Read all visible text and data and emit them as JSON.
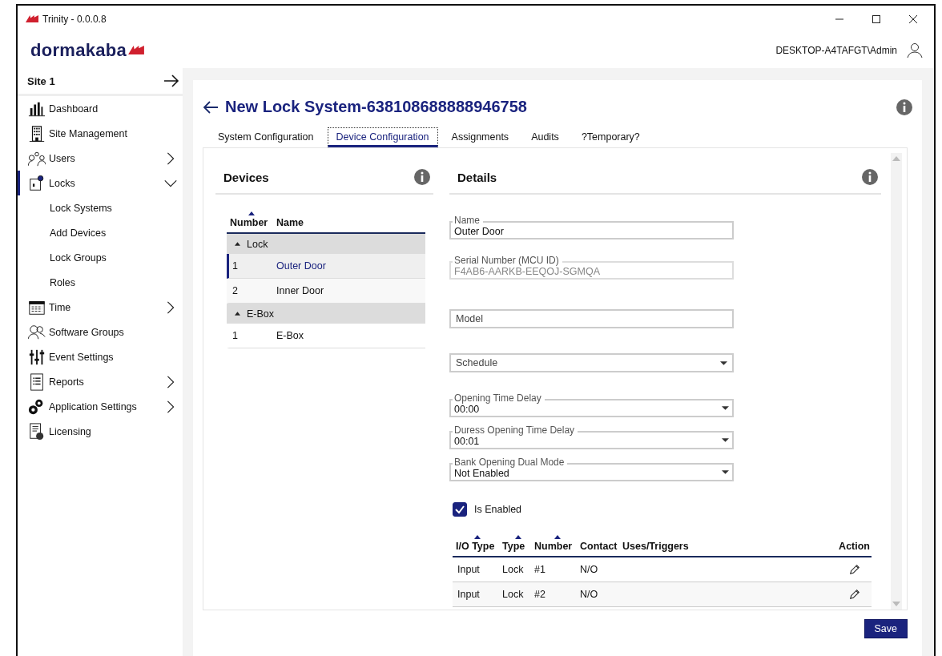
{
  "window": {
    "title": "Trinity - 0.0.0.8"
  },
  "header": {
    "logo": "dormakaba",
    "user": "DESKTOP-A4TAFGT\\Admin"
  },
  "sidebar": {
    "site": "Site 1",
    "items": [
      {
        "label": "Dashboard",
        "selected": false
      },
      {
        "label": "Site Management",
        "selected": false
      },
      {
        "label": "Users",
        "selected": false,
        "expanded": false
      },
      {
        "label": "Locks",
        "selected": true,
        "expanded": true,
        "children": [
          {
            "label": "Lock Systems"
          },
          {
            "label": "Add Devices"
          },
          {
            "label": "Lock Groups"
          },
          {
            "label": "Roles"
          }
        ]
      },
      {
        "label": "Time",
        "selected": false,
        "expanded": false
      },
      {
        "label": "Software Groups",
        "selected": false
      },
      {
        "label": "Event Settings",
        "selected": false
      },
      {
        "label": "Reports",
        "selected": false,
        "expanded": false
      },
      {
        "label": "Application Settings",
        "selected": false,
        "expanded": false
      },
      {
        "label": "Licensing",
        "selected": false
      }
    ]
  },
  "page": {
    "title": "New Lock System-638108688888946758",
    "tabs": [
      {
        "label": "System Configuration",
        "selected": false
      },
      {
        "label": "Device Configuration",
        "selected": true
      },
      {
        "label": "Assignments",
        "selected": false
      },
      {
        "label": "Audits",
        "selected": false
      },
      {
        "label": "?Temporary?",
        "selected": false
      }
    ],
    "devices": {
      "title": "Devices",
      "columns": [
        {
          "label": "Number",
          "sorted": true
        },
        {
          "label": "Name",
          "sorted": false
        }
      ],
      "groups": [
        {
          "name": "Lock",
          "expanded": true,
          "rows": [
            {
              "number": "1",
              "name": "Outer Door",
              "selected": true
            },
            {
              "number": "2",
              "name": "Inner Door",
              "selected": false
            }
          ]
        },
        {
          "name": "E-Box",
          "expanded": true,
          "rows": [
            {
              "number": "1",
              "name": "E-Box",
              "selected": false
            }
          ]
        }
      ]
    },
    "details": {
      "title": "Details",
      "fields": [
        {
          "kind": "text",
          "label": "Name",
          "value": "Outer Door",
          "disabled": false
        },
        {
          "kind": "text",
          "label": "Serial Number (MCU ID)",
          "value": "F4AB6-AARKB-EEQOJ-SGMQA",
          "disabled": true
        },
        {
          "kind": "text",
          "placeholder": "Model",
          "disabled": false
        },
        {
          "kind": "select",
          "placeholder": "Schedule",
          "disabled": false
        },
        {
          "kind": "select",
          "label": "Opening Time Delay",
          "value": "00:00",
          "disabled": false
        },
        {
          "kind": "select",
          "label": "Duress Opening Time Delay",
          "value": "00:01",
          "disabled": false
        },
        {
          "kind": "select",
          "label": "Bank Opening Dual Mode",
          "value": "Not Enabled",
          "disabled": false
        }
      ],
      "checkbox": {
        "label": "Is Enabled",
        "checked": true
      },
      "io_table": {
        "columns": [
          {
            "label": "I/O Type",
            "sorted": true
          },
          {
            "label": "Type",
            "sorted": true
          },
          {
            "label": "Number",
            "sorted": true
          },
          {
            "label": "Contact",
            "sorted": false
          },
          {
            "label": "Uses/Triggers",
            "sorted": false
          },
          {
            "label": "Action",
            "sorted": false
          }
        ],
        "rows": [
          {
            "io_type": "Input",
            "type": "Lock",
            "number": "#1",
            "contact": "N/O",
            "uses": ""
          },
          {
            "io_type": "Input",
            "type": "Lock",
            "number": "#2",
            "contact": "N/O",
            "uses": ""
          }
        ]
      }
    },
    "save": "Save"
  }
}
